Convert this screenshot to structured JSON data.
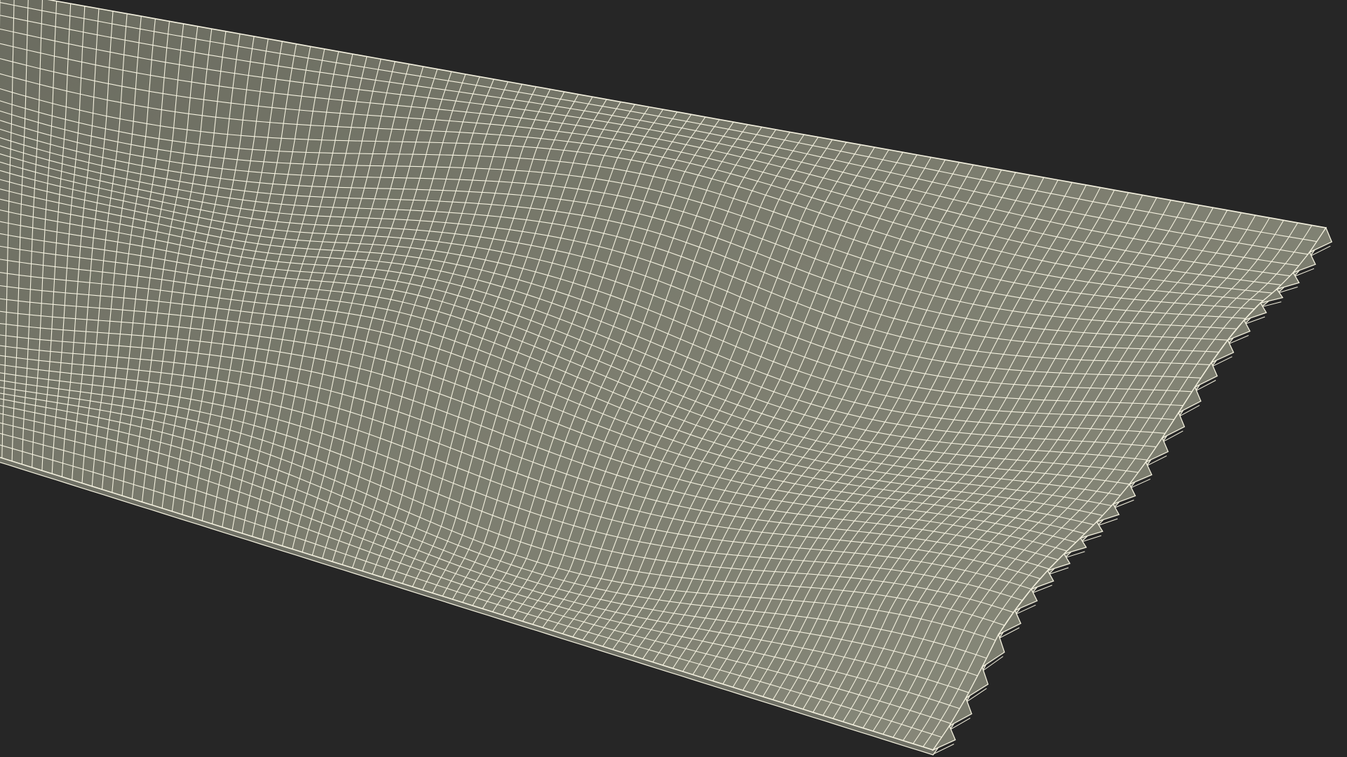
{
  "viewport": {
    "background_color": "#262626"
  },
  "mesh": {
    "name": "sachet-wrapper-wireframe",
    "fill_color": "#7c7d6f",
    "fill_highlight": "#8a8b7c",
    "fill_shadow": "#6a6b5f",
    "edge_face_color": "#6f7065",
    "wire_color": "#f4f1df",
    "serrated_edge": true,
    "serration_teeth": 24
  }
}
